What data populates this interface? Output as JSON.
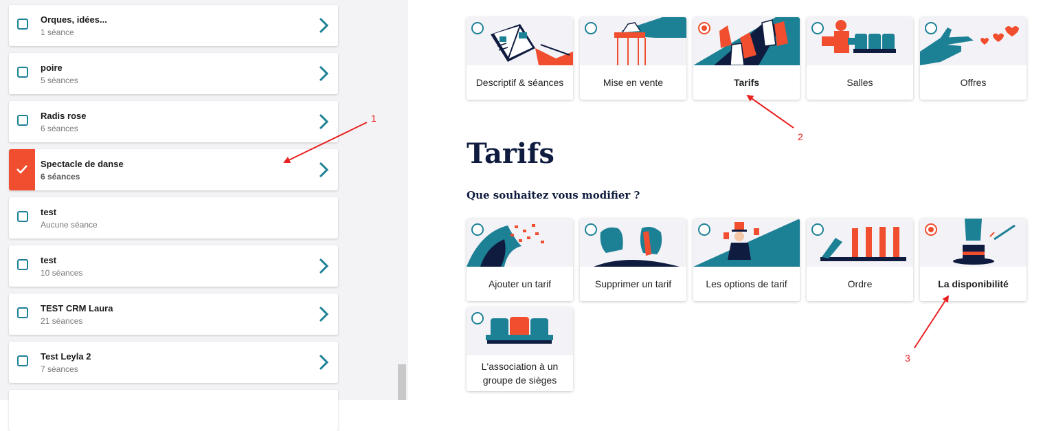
{
  "show_list": [
    {
      "title": "Orques, idées...",
      "subtitle": "1 séance",
      "selected": false,
      "has_arrow": true
    },
    {
      "title": "poire",
      "subtitle": "5 séances",
      "selected": false,
      "has_arrow": true
    },
    {
      "title": "Radis rose",
      "subtitle": "6 séances",
      "selected": false,
      "has_arrow": true
    },
    {
      "title": "Spectacle de danse",
      "subtitle": "6 séances",
      "selected": true,
      "has_arrow": true
    },
    {
      "title": "test",
      "subtitle": "Aucune séance",
      "selected": false,
      "has_arrow": false
    },
    {
      "title": "test",
      "subtitle": "10 séances",
      "selected": false,
      "has_arrow": true
    },
    {
      "title": "TEST CRM Laura",
      "subtitle": "21 séances",
      "selected": false,
      "has_arrow": true
    },
    {
      "title": "Test Leyla 2",
      "subtitle": "7 séances",
      "selected": false,
      "has_arrow": true
    }
  ],
  "sections": [
    {
      "label": "Descriptif & séances",
      "selected": false,
      "icon": "book-icon"
    },
    {
      "label": "Mise en vente",
      "selected": false,
      "icon": "puppet-strings-icon"
    },
    {
      "label": "Tarifs",
      "selected": true,
      "icon": "hands-cards-icon"
    },
    {
      "label": "Salles",
      "selected": false,
      "icon": "usher-seats-icon"
    },
    {
      "label": "Offres",
      "selected": false,
      "icon": "finger-gun-hearts-icon"
    }
  ],
  "heading": "Tarifs",
  "question": "Que souhaitez vous modifier ?",
  "options": [
    {
      "label": "Ajouter un tarif",
      "selected": false,
      "icon": "wave-icon"
    },
    {
      "label": "Supprimer un tarif",
      "selected": false,
      "icon": "feet-icon"
    },
    {
      "label": "Les options de tarif",
      "selected": false,
      "icon": "magician-icon"
    },
    {
      "label": "Ordre",
      "selected": false,
      "icon": "dominoes-icon"
    },
    {
      "label": "La disponibilité",
      "selected": true,
      "icon": "magic-hat-icon"
    },
    {
      "label": "L'association à un groupe de sièges",
      "selected": false,
      "icon": "seats-group-icon"
    }
  ],
  "annotations": [
    "1",
    "2",
    "3"
  ],
  "colors": {
    "accent_red": "#f04e2e",
    "teal": "#1d8196",
    "navy": "#0f1c3f",
    "annotation_red": "#e82020"
  }
}
